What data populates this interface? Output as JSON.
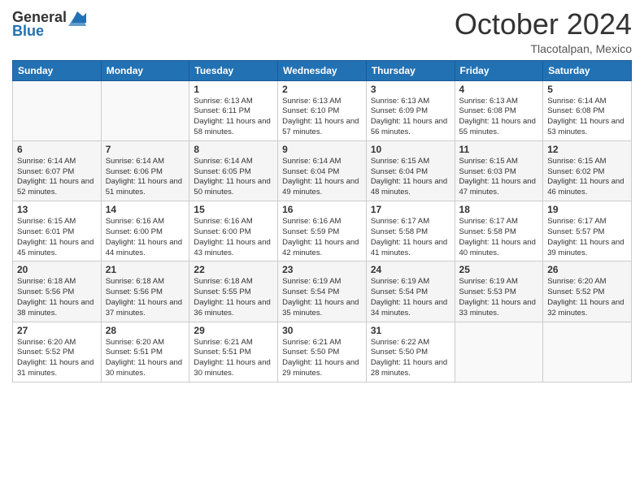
{
  "header": {
    "logo_text_general": "General",
    "logo_text_blue": "Blue",
    "month_title": "October 2024",
    "subtitle": "Tlacotalpan, Mexico"
  },
  "days_of_week": [
    "Sunday",
    "Monday",
    "Tuesday",
    "Wednesday",
    "Thursday",
    "Friday",
    "Saturday"
  ],
  "weeks": [
    [
      {
        "day": "",
        "sunrise": "",
        "sunset": "",
        "daylight": ""
      },
      {
        "day": "",
        "sunrise": "",
        "sunset": "",
        "daylight": ""
      },
      {
        "day": "1",
        "sunrise": "Sunrise: 6:13 AM",
        "sunset": "Sunset: 6:11 PM",
        "daylight": "Daylight: 11 hours and 58 minutes."
      },
      {
        "day": "2",
        "sunrise": "Sunrise: 6:13 AM",
        "sunset": "Sunset: 6:10 PM",
        "daylight": "Daylight: 11 hours and 57 minutes."
      },
      {
        "day": "3",
        "sunrise": "Sunrise: 6:13 AM",
        "sunset": "Sunset: 6:09 PM",
        "daylight": "Daylight: 11 hours and 56 minutes."
      },
      {
        "day": "4",
        "sunrise": "Sunrise: 6:13 AM",
        "sunset": "Sunset: 6:08 PM",
        "daylight": "Daylight: 11 hours and 55 minutes."
      },
      {
        "day": "5",
        "sunrise": "Sunrise: 6:14 AM",
        "sunset": "Sunset: 6:08 PM",
        "daylight": "Daylight: 11 hours and 53 minutes."
      }
    ],
    [
      {
        "day": "6",
        "sunrise": "Sunrise: 6:14 AM",
        "sunset": "Sunset: 6:07 PM",
        "daylight": "Daylight: 11 hours and 52 minutes."
      },
      {
        "day": "7",
        "sunrise": "Sunrise: 6:14 AM",
        "sunset": "Sunset: 6:06 PM",
        "daylight": "Daylight: 11 hours and 51 minutes."
      },
      {
        "day": "8",
        "sunrise": "Sunrise: 6:14 AM",
        "sunset": "Sunset: 6:05 PM",
        "daylight": "Daylight: 11 hours and 50 minutes."
      },
      {
        "day": "9",
        "sunrise": "Sunrise: 6:14 AM",
        "sunset": "Sunset: 6:04 PM",
        "daylight": "Daylight: 11 hours and 49 minutes."
      },
      {
        "day": "10",
        "sunrise": "Sunrise: 6:15 AM",
        "sunset": "Sunset: 6:04 PM",
        "daylight": "Daylight: 11 hours and 48 minutes."
      },
      {
        "day": "11",
        "sunrise": "Sunrise: 6:15 AM",
        "sunset": "Sunset: 6:03 PM",
        "daylight": "Daylight: 11 hours and 47 minutes."
      },
      {
        "day": "12",
        "sunrise": "Sunrise: 6:15 AM",
        "sunset": "Sunset: 6:02 PM",
        "daylight": "Daylight: 11 hours and 46 minutes."
      }
    ],
    [
      {
        "day": "13",
        "sunrise": "Sunrise: 6:15 AM",
        "sunset": "Sunset: 6:01 PM",
        "daylight": "Daylight: 11 hours and 45 minutes."
      },
      {
        "day": "14",
        "sunrise": "Sunrise: 6:16 AM",
        "sunset": "Sunset: 6:00 PM",
        "daylight": "Daylight: 11 hours and 44 minutes."
      },
      {
        "day": "15",
        "sunrise": "Sunrise: 6:16 AM",
        "sunset": "Sunset: 6:00 PM",
        "daylight": "Daylight: 11 hours and 43 minutes."
      },
      {
        "day": "16",
        "sunrise": "Sunrise: 6:16 AM",
        "sunset": "Sunset: 5:59 PM",
        "daylight": "Daylight: 11 hours and 42 minutes."
      },
      {
        "day": "17",
        "sunrise": "Sunrise: 6:17 AM",
        "sunset": "Sunset: 5:58 PM",
        "daylight": "Daylight: 11 hours and 41 minutes."
      },
      {
        "day": "18",
        "sunrise": "Sunrise: 6:17 AM",
        "sunset": "Sunset: 5:58 PM",
        "daylight": "Daylight: 11 hours and 40 minutes."
      },
      {
        "day": "19",
        "sunrise": "Sunrise: 6:17 AM",
        "sunset": "Sunset: 5:57 PM",
        "daylight": "Daylight: 11 hours and 39 minutes."
      }
    ],
    [
      {
        "day": "20",
        "sunrise": "Sunrise: 6:18 AM",
        "sunset": "Sunset: 5:56 PM",
        "daylight": "Daylight: 11 hours and 38 minutes."
      },
      {
        "day": "21",
        "sunrise": "Sunrise: 6:18 AM",
        "sunset": "Sunset: 5:56 PM",
        "daylight": "Daylight: 11 hours and 37 minutes."
      },
      {
        "day": "22",
        "sunrise": "Sunrise: 6:18 AM",
        "sunset": "Sunset: 5:55 PM",
        "daylight": "Daylight: 11 hours and 36 minutes."
      },
      {
        "day": "23",
        "sunrise": "Sunrise: 6:19 AM",
        "sunset": "Sunset: 5:54 PM",
        "daylight": "Daylight: 11 hours and 35 minutes."
      },
      {
        "day": "24",
        "sunrise": "Sunrise: 6:19 AM",
        "sunset": "Sunset: 5:54 PM",
        "daylight": "Daylight: 11 hours and 34 minutes."
      },
      {
        "day": "25",
        "sunrise": "Sunrise: 6:19 AM",
        "sunset": "Sunset: 5:53 PM",
        "daylight": "Daylight: 11 hours and 33 minutes."
      },
      {
        "day": "26",
        "sunrise": "Sunrise: 6:20 AM",
        "sunset": "Sunset: 5:52 PM",
        "daylight": "Daylight: 11 hours and 32 minutes."
      }
    ],
    [
      {
        "day": "27",
        "sunrise": "Sunrise: 6:20 AM",
        "sunset": "Sunset: 5:52 PM",
        "daylight": "Daylight: 11 hours and 31 minutes."
      },
      {
        "day": "28",
        "sunrise": "Sunrise: 6:20 AM",
        "sunset": "Sunset: 5:51 PM",
        "daylight": "Daylight: 11 hours and 30 minutes."
      },
      {
        "day": "29",
        "sunrise": "Sunrise: 6:21 AM",
        "sunset": "Sunset: 5:51 PM",
        "daylight": "Daylight: 11 hours and 30 minutes."
      },
      {
        "day": "30",
        "sunrise": "Sunrise: 6:21 AM",
        "sunset": "Sunset: 5:50 PM",
        "daylight": "Daylight: 11 hours and 29 minutes."
      },
      {
        "day": "31",
        "sunrise": "Sunrise: 6:22 AM",
        "sunset": "Sunset: 5:50 PM",
        "daylight": "Daylight: 11 hours and 28 minutes."
      },
      {
        "day": "",
        "sunrise": "",
        "sunset": "",
        "daylight": ""
      },
      {
        "day": "",
        "sunrise": "",
        "sunset": "",
        "daylight": ""
      }
    ]
  ]
}
